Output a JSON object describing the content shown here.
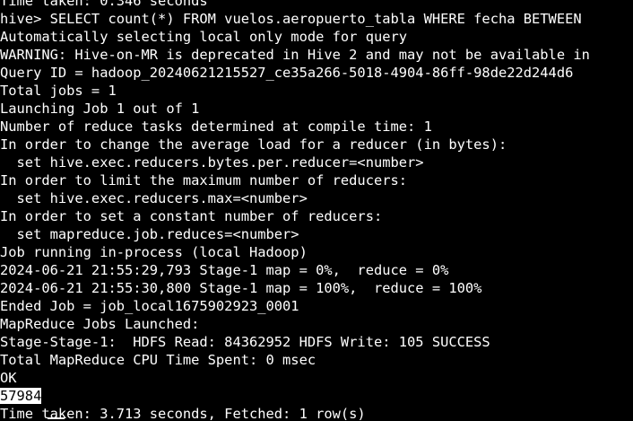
{
  "terminal": {
    "lines": [
      "Time taken: 0.346 seconds",
      "hive> SELECT count(*) FROM vuelos.aeropuerto_tabla WHERE fecha BETWEEN",
      "Automatically selecting local only mode for query",
      "WARNING: Hive-on-MR is deprecated in Hive 2 and may not be available in",
      "Query ID = hadoop_20240621215527_ce35a266-5018-4904-86ff-98de22d244d6",
      "Total jobs = 1",
      "Launching Job 1 out of 1",
      "Number of reduce tasks determined at compile time: 1",
      "In order to change the average load for a reducer (in bytes):",
      "  set hive.exec.reducers.bytes.per.reducer=<number>",
      "In order to limit the maximum number of reducers:",
      "  set hive.exec.reducers.max=<number>",
      "In order to set a constant number of reducers:",
      "  set mapreduce.job.reduces=<number>",
      "Job running in-process (local Hadoop)",
      "2024-06-21 21:55:29,793 Stage-1 map = 0%,  reduce = 0%",
      "2024-06-21 21:55:30,800 Stage-1 map = 100%,  reduce = 100%",
      "Ended Job = job_local1675902923_0001",
      "MapReduce Jobs Launched:",
      "Stage-Stage-1:  HDFS Read: 84362952 HDFS Write: 105 SUCCESS",
      "Total MapReduce CPU Time Spent: 0 msec",
      "OK"
    ],
    "result_value": "57984",
    "final_line": "Time taken: 3.713 seconds, Fetched: 1 row(s)"
  }
}
